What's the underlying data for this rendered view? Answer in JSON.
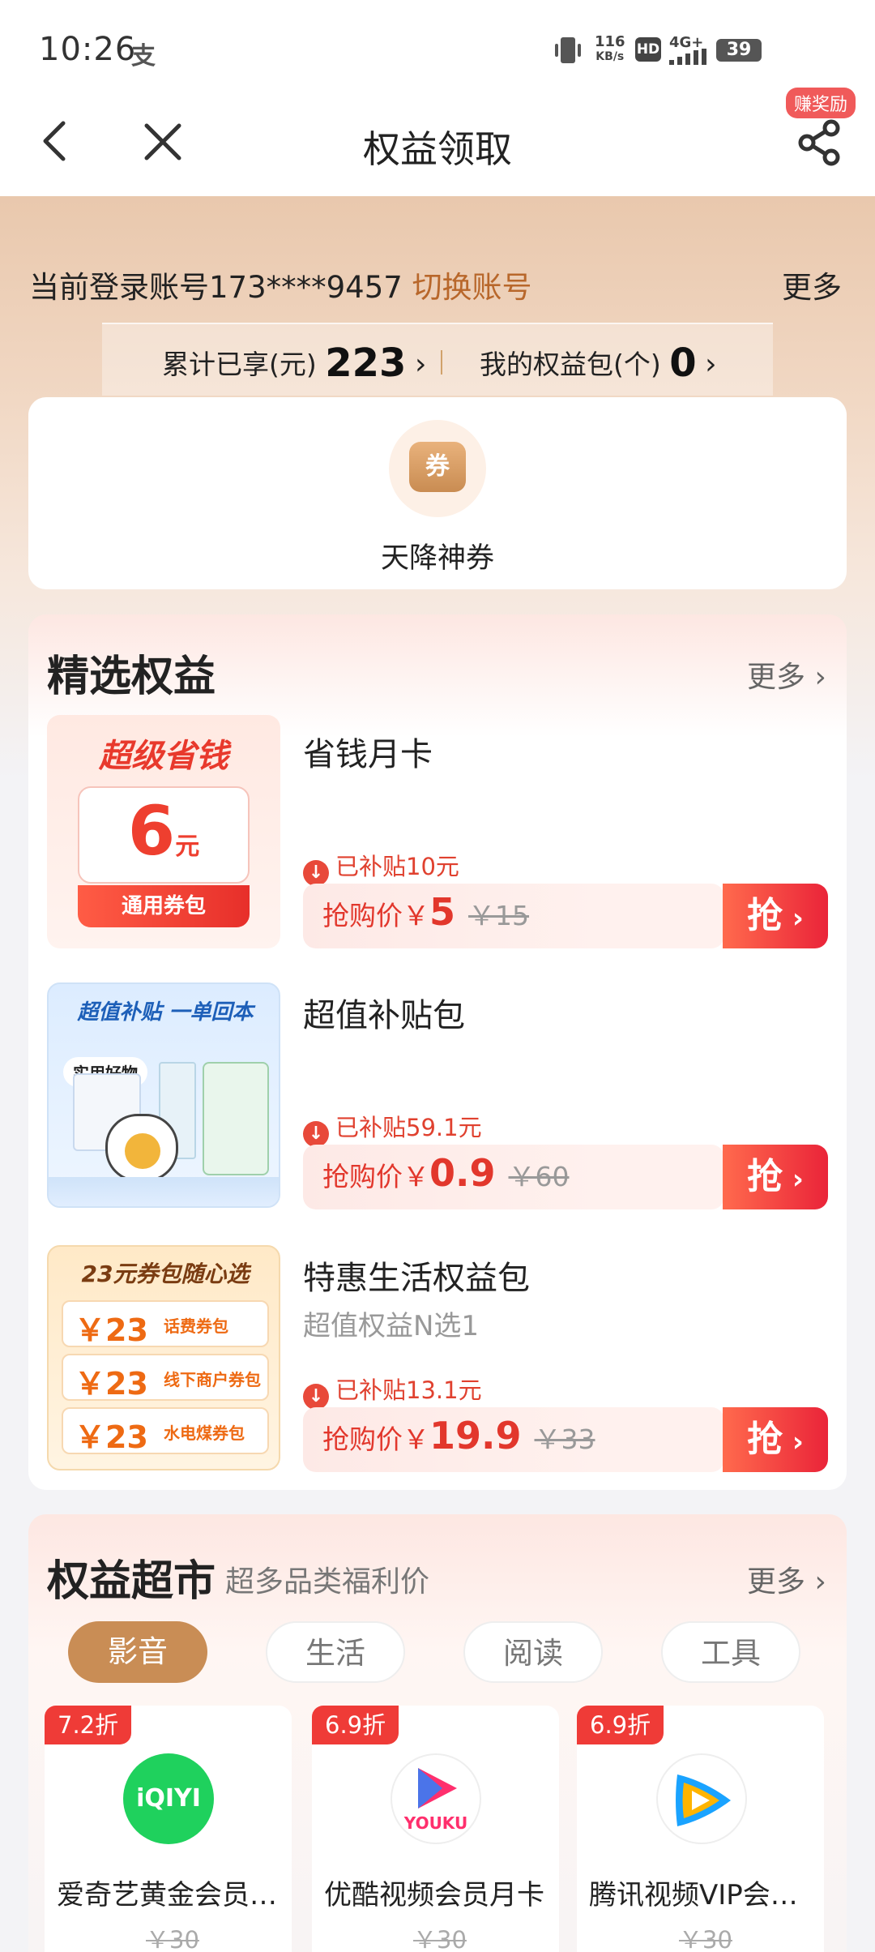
{
  "status_bar": {
    "time": "10:26",
    "app_glyph": "支",
    "speed_value": "116",
    "speed_unit": "KB/s",
    "hd": "HD",
    "network": "4G+",
    "battery": "39"
  },
  "title_bar": {
    "title": "权益领取",
    "share_badge": "赚奖励"
  },
  "account": {
    "login_label": "当前登录账号173****9457",
    "switch_label": "切换账号",
    "more": "更多"
  },
  "stats": {
    "enjoyed_label": "累计已享(元)",
    "enjoyed_value": "223",
    "package_label": "我的权益包(个)",
    "package_value": "0"
  },
  "coupon": {
    "icon_text": "券",
    "label": "天降神券"
  },
  "featured": {
    "title": "精选权益",
    "more": "更多",
    "items": [
      {
        "title": "省钱月卡",
        "subtitle": "",
        "subsidy": "已补贴10元",
        "price_label": "抢购价￥",
        "price": "5",
        "old_price": "￥15",
        "grab": "抢",
        "thumb": {
          "banner": "超级省钱",
          "amount": "6",
          "unit": "元",
          "button": "通用券包"
        }
      },
      {
        "title": "超值补贴包",
        "subtitle": "",
        "subsidy": "已补贴59.1元",
        "price_label": "抢购价￥",
        "price": "0.9",
        "old_price": "￥60",
        "grab": "抢",
        "thumb": {
          "banner": "超值补贴 一单回本",
          "tag": "实用好物"
        }
      },
      {
        "title": "特惠生活权益包",
        "subtitle": "超值权益N选1",
        "subsidy": "已补贴13.1元",
        "price_label": "抢购价￥",
        "price": "19.9",
        "old_price": "￥33",
        "grab": "抢",
        "thumb": {
          "banner": "23元券包随心选",
          "rows": [
            {
              "amount": "￥23",
              "label": "话费券包"
            },
            {
              "amount": "￥23",
              "label": "线下商户券包"
            },
            {
              "amount": "￥23",
              "label": "水电煤券包"
            }
          ]
        }
      }
    ]
  },
  "market": {
    "title": "权益超市",
    "subtitle": "超多品类福利价",
    "more": "更多",
    "tabs": [
      "影音",
      "生活",
      "阅读",
      "工具"
    ],
    "active_tab": 0,
    "products": [
      {
        "discount": "7.2折",
        "logo": "iQIYI",
        "name": "爱奇艺黄金会员…",
        "old_price": "￥30",
        "color": "#1fd15d"
      },
      {
        "discount": "6.9折",
        "logo": "YOUKU",
        "name": "优酷视频会员月卡",
        "old_price": "￥30",
        "color": "#ff2f6d"
      },
      {
        "discount": "6.9折",
        "logo": "tencent-video",
        "name": "腾讯视频VIP会…",
        "old_price": "￥30",
        "color": "#21a1ff"
      }
    ]
  }
}
